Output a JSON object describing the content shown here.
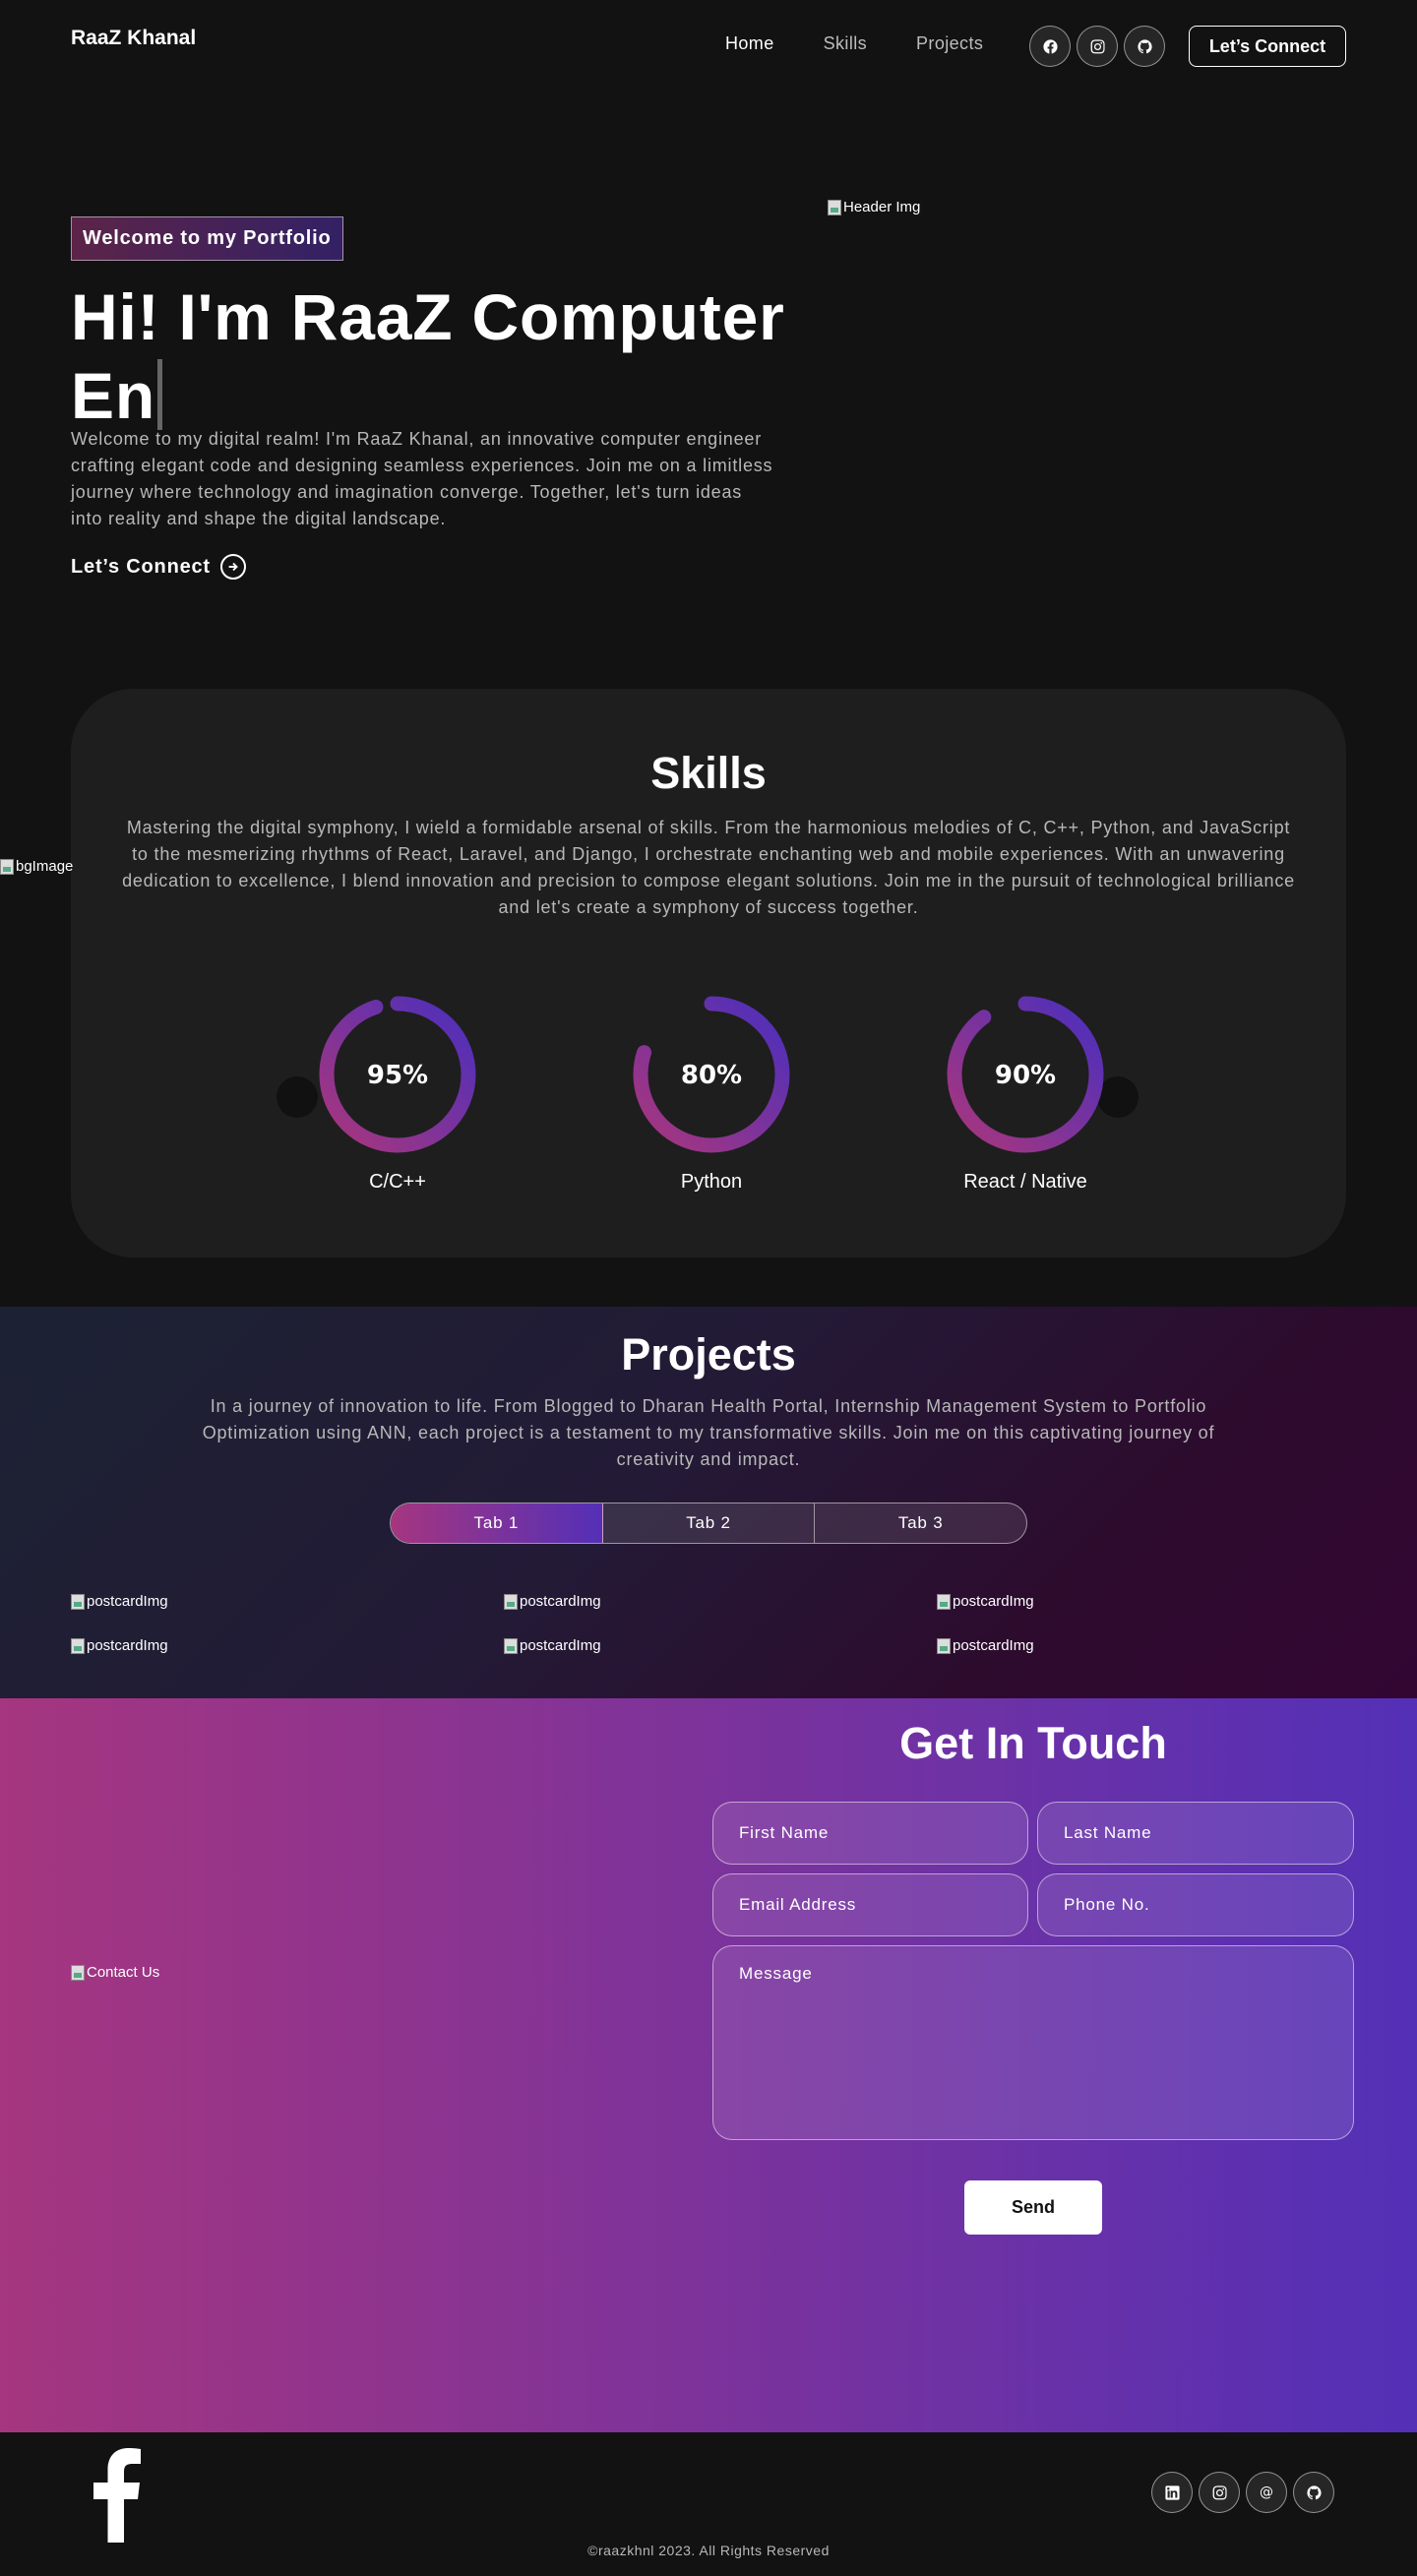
{
  "nav": {
    "brand": "RaaZ Khanal",
    "links": [
      {
        "label": "Home",
        "active": true
      },
      {
        "label": "Skills",
        "active": false
      },
      {
        "label": "Projects",
        "active": false
      }
    ],
    "social_icons": [
      "facebook-icon",
      "instagram-icon",
      "github-icon"
    ],
    "connect_label": "Let’s Connect"
  },
  "hero": {
    "tagline": "Welcome to my Portfolio",
    "title": "Hi! I'm RaaZ Computer En",
    "description": "Welcome to my digital realm! I'm RaaZ Khanal, an innovative computer engineer crafting elegant code and designing seamless experiences. Join me on a limitless journey where technology and imagination converge. Together, let's turn ideas into reality and shape the digital landscape.",
    "connect_label": "Let’s Connect",
    "header_img_alt": "Header Img"
  },
  "skills": {
    "bg_img_alt": "bgImage",
    "title": "Skills",
    "description": "Mastering the digital symphony, I wield a formidable arsenal of skills. From the harmonious melodies of C, C++, Python, and JavaScript to the mesmerizing rhythms of React, Laravel, and Django, I orchestrate enchanting web and mobile experiences. With an unwavering dedication to excellence, I blend innovation and precision to compose elegant solutions. Join me in the pursuit of technological brilliance and let's create a symphony of success together.",
    "items": [
      {
        "label": "C/C++",
        "percent_text": "95%",
        "percent": 95
      },
      {
        "label": "Python",
        "percent_text": "80%",
        "percent": 80
      },
      {
        "label": "React / Native",
        "percent_text": "90%",
        "percent": 90
      }
    ],
    "prev_glyph": "",
    "next_glyph": ""
  },
  "projects": {
    "title": "Projects",
    "description": "In a journey of innovation to life. From Blogged to Dharan Health Portal, Internship Management System to Portfolio Optimization using ANN, each project is a testament to my transformative skills. Join me on this captivating journey of creativity and impact.",
    "tabs": [
      {
        "label": "Tab 1",
        "active": true
      },
      {
        "label": "Tab 2",
        "active": false
      },
      {
        "label": "Tab 3",
        "active": false
      }
    ],
    "card_img_alt": "postcardImg"
  },
  "contact": {
    "img_alt": "Contact Us",
    "title": "Get In Touch",
    "placeholders": {
      "first_name": "First Name",
      "last_name": "Last Name",
      "email": "Email Address",
      "phone": "Phone No.",
      "message": "Message"
    },
    "send_label": "Send"
  },
  "footer": {
    "logo_icon": "facebook-logo-icon",
    "social_icons": [
      "linkedin-icon",
      "instagram-icon",
      "at-sign-icon",
      "github-icon"
    ],
    "at_glyph": "@",
    "copyright": "©raazkhnl 2023. All Rights Reserved"
  },
  "colors": {
    "background": "#121212",
    "gradient_start": "#AA367C",
    "gradient_end": "#4A2FBD",
    "muted_text": "#B8B8B8"
  }
}
